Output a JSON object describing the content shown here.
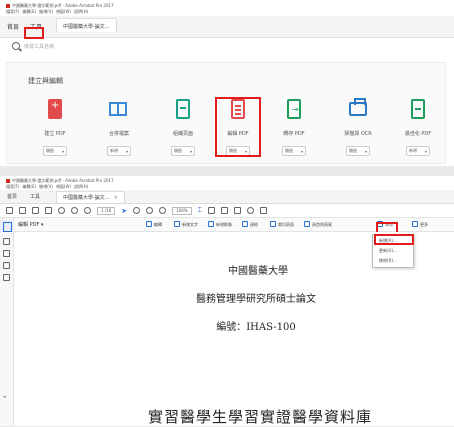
{
  "top": {
    "window_title": "中國醫藥大學-論文範例.pdf - Adobe Acrobat Pro 2017",
    "menu": [
      "檔案(F)",
      "編輯(E)",
      "檢視(V)",
      "視窗(W)",
      "說明(H)"
    ],
    "tabs": {
      "home": "首頁",
      "tools": "工具",
      "doc": "中國醫藥大學-論文..."
    },
    "search_placeholder": "搜尋工具名稱",
    "section_title": "建立與編輯",
    "tools": [
      {
        "label": "建立 PDF",
        "button": "開啟"
      },
      {
        "label": "合併檔案",
        "button": "新增"
      },
      {
        "label": "組織頁面",
        "button": "開啟"
      },
      {
        "label": "編輯 PDF",
        "button": "開啟"
      },
      {
        "label": "轉存 PDF",
        "button": "開啟"
      },
      {
        "label": "掃描與 OCR",
        "button": "開啟"
      },
      {
        "label": "最佳化 PDF",
        "button": "新增"
      }
    ]
  },
  "bottom": {
    "window_title": "中國醫藥大學-論文範例.pdf - Adobe Acrobat Pro 2017",
    "menu": [
      "檔案(F)",
      "編輯(E)",
      "檢視(V)",
      "視窗(W)",
      "說明(H)"
    ],
    "tabs": {
      "home": "首頁",
      "tools": "工具",
      "doc": "中國醫藥大學-論文...",
      "close": "×"
    },
    "page_indicator": "1 /16",
    "zoom": "100%",
    "edit_pdf_title": "編輯 PDF ▾",
    "edit_bar": {
      "edit": "編輯",
      "add_text": "新增文字",
      "add_image": "新增影像",
      "link": "連結",
      "crop": "裁切頁面",
      "header_footer": "頁首與頁尾",
      "watermark": "水印",
      "more": "更多"
    },
    "dropdown": {
      "new": "新增(A)...",
      "update": "更新(U)...",
      "remove": "移除(R)..."
    },
    "document_lines": [
      "中國醫藥大學",
      "醫務管理學研究所碩士論文",
      "編號：IHAS-100",
      "實習醫學生學習實證醫學資料庫"
    ]
  },
  "colors": {
    "highlight": "#e21b1b",
    "accent": "#2b6fd5"
  }
}
